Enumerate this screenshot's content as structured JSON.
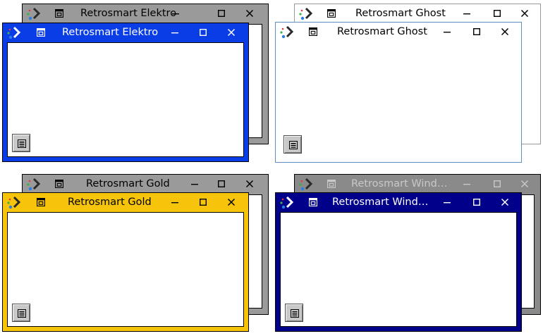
{
  "windows": {
    "elektro_back": {
      "title": "Retrosmart Elektro"
    },
    "elektro_front": {
      "title": "Retrosmart Elektro"
    },
    "ghost_back": {
      "title": "Retrosmart Ghost"
    },
    "ghost_front": {
      "title": "Retrosmart Ghost"
    },
    "gold_back": {
      "title": "Retrosmart Gold"
    },
    "gold_front": {
      "title": "Retrosmart Gold"
    },
    "win9x_back": {
      "title": "Retrosmart Windo..."
    },
    "win9x_front": {
      "title": "Retrosmart Windo..."
    }
  },
  "colors": {
    "elektro": "#0a3de6",
    "gold": "#f6c40a",
    "windows": "#00008a",
    "inactive": "#9a9a9a",
    "ghost_border": "#5a8fc0"
  },
  "icons": {
    "logo": "retrosmart-logo-icon",
    "menu": "window-menu-icon",
    "minimize": "minimize-icon",
    "maximize": "maximize-icon",
    "close": "close-icon",
    "system": "system-menu-icon"
  }
}
